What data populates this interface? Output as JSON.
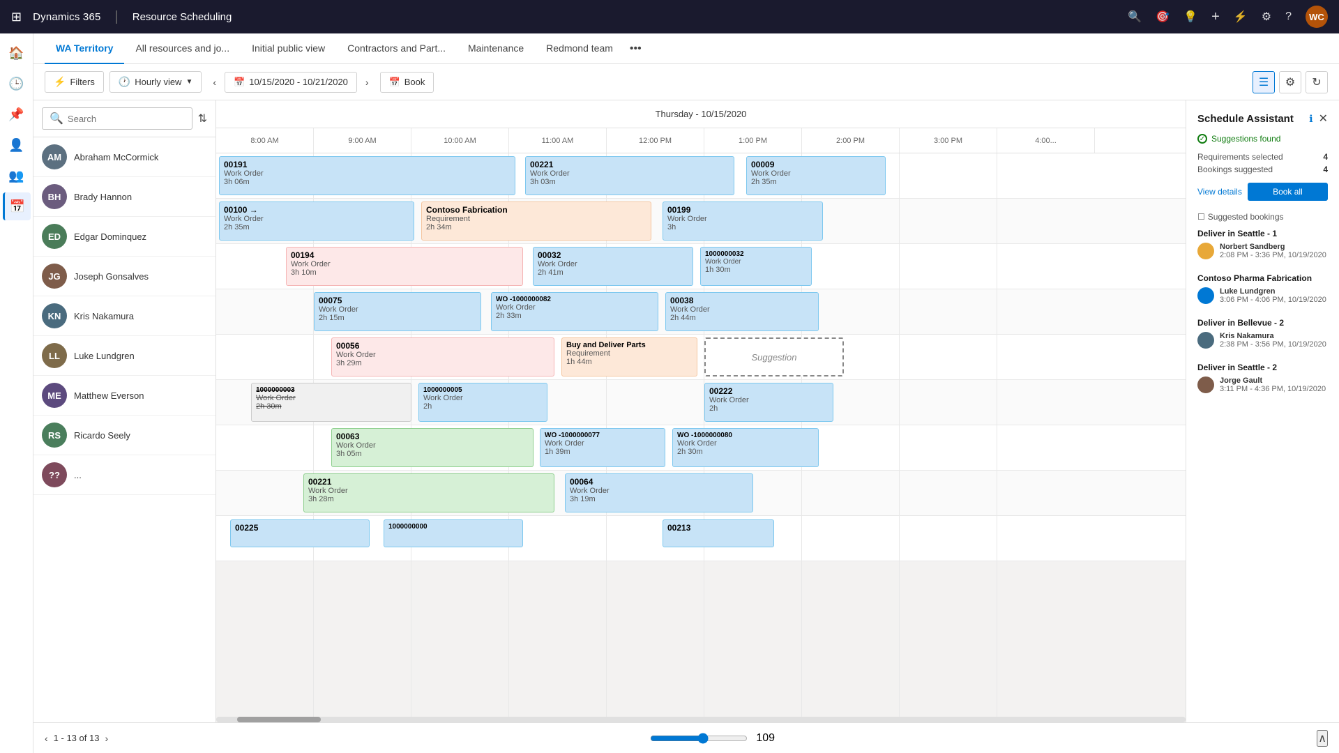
{
  "app": {
    "brand": "Dynamics 365",
    "separator": "|",
    "title": "Resource Scheduling",
    "avatar_text": "WC"
  },
  "tabs": [
    {
      "label": "WA Territory",
      "active": true
    },
    {
      "label": "All resources and jo...",
      "active": false
    },
    {
      "label": "Initial public view",
      "active": false
    },
    {
      "label": "Contractors and Part...",
      "active": false
    },
    {
      "label": "Maintenance",
      "active": false
    },
    {
      "label": "Redmond team",
      "active": false
    }
  ],
  "toolbar": {
    "filters_label": "Filters",
    "hourly_view_label": "Hourly view",
    "date_range": "10/15/2020 - 10/21/2020",
    "book_label": "Book"
  },
  "search": {
    "placeholder": "Search"
  },
  "day_header": "Thursday - 10/15/2020",
  "time_slots": [
    "8:00 AM",
    "9:00 AM",
    "10:00 AM",
    "11:00 AM",
    "12:00 PM",
    "1:00 PM",
    "2:00 PM",
    "3:00 PM"
  ],
  "resources": [
    {
      "name": "Abraham McCormick",
      "initials": "AM",
      "color": "#5c7080"
    },
    {
      "name": "Brady Hannon",
      "initials": "BH",
      "color": "#6b5c7e"
    },
    {
      "name": "Edgar Dominquez",
      "initials": "ED",
      "color": "#4a7c59"
    },
    {
      "name": "Joseph Gonsalves",
      "initials": "JG",
      "color": "#7e5c4a"
    },
    {
      "name": "Kris Nakamura",
      "initials": "KN",
      "color": "#4a6b7e"
    },
    {
      "name": "Luke Lundgren",
      "initials": "LL",
      "color": "#7e6b4a"
    },
    {
      "name": "Matthew Everson",
      "initials": "ME",
      "color": "#5c4a7e"
    },
    {
      "name": "Ricardo Seely",
      "initials": "RS",
      "color": "#4a7e5c"
    }
  ],
  "schedule_assistant": {
    "title": "Schedule Assistant",
    "status": "Suggestions found",
    "requirements_selected": 4,
    "bookings_suggested": 4,
    "view_details_label": "View details",
    "book_all_label": "Book all",
    "suggested_bookings_label": "Suggested bookings",
    "groups": [
      {
        "title": "Deliver in Seattle - 1",
        "bookings": [
          {
            "name": "Norbert Sandberg",
            "time": "2:08 PM - 3:36 PM, 10/19/2020",
            "color": "#e8a838"
          }
        ]
      },
      {
        "title": "Contoso Pharma Fabrication",
        "bookings": [
          {
            "name": "Luke Lundgren",
            "time": "3:06 PM - 4:06 PM, 10/19/2020",
            "color": "#0078d4"
          }
        ]
      },
      {
        "title": "Deliver in Bellevue - 2",
        "bookings": [
          {
            "name": "Kris Nakamura",
            "time": "2:38 PM - 3:56 PM, 10/19/2020",
            "color": "#4a6b7e"
          }
        ]
      },
      {
        "title": "Deliver in Seattle - 2",
        "bookings": [
          {
            "name": "Jorge Gault",
            "time": "3:11 PM - 4:36 PM, 10/19/2020",
            "color": "#7e5c4a"
          }
        ]
      }
    ]
  },
  "pagination": {
    "current": "1 - 13 of 13"
  },
  "zoom_value": "109"
}
